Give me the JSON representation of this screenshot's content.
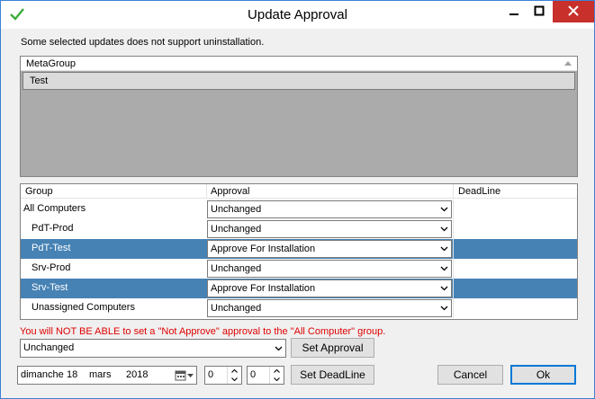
{
  "window": {
    "title": "Update Approval",
    "app_icon": "green-check-icon",
    "controls": [
      "minimize-icon",
      "maximize-icon",
      "close-icon"
    ]
  },
  "notice": "Some selected updates does not support uninstallation.",
  "metagroup_panel": {
    "header": "MetaGroup",
    "rows": [
      "Test"
    ]
  },
  "groups_panel": {
    "headers": {
      "group": "Group",
      "approval": "Approval",
      "deadline": "DeadLine"
    },
    "rows": [
      {
        "name": "All Computers",
        "approval": "Unchanged",
        "selected": false
      },
      {
        "name": "PdT-Prod",
        "approval": "Unchanged",
        "selected": false
      },
      {
        "name": "PdT-Test",
        "approval": "Approve For Installation",
        "selected": true
      },
      {
        "name": "Srv-Prod",
        "approval": "Unchanged",
        "selected": false
      },
      {
        "name": "Srv-Test",
        "approval": "Approve For Installation",
        "selected": true
      },
      {
        "name": "Unassigned Computers",
        "approval": "Unchanged",
        "selected": false
      }
    ]
  },
  "warning": "You will NOT BE ABLE to set a \"Not Approve\" approval to the \"All Computer\" group.",
  "approval_combo": {
    "value": "Unchanged"
  },
  "buttons": {
    "set_approval": "Set Approval",
    "set_deadline": "Set DeadLine",
    "cancel": "Cancel",
    "ok": "Ok"
  },
  "deadline": {
    "weekday": "dimanche",
    "day": "18",
    "month": "mars",
    "year": "2018",
    "hours": "0",
    "minutes": "0"
  },
  "colors": {
    "selected_row": "#4682b4",
    "warning_text": "#e00000",
    "close_button": "#c7302b",
    "empty_panel": "#ababab"
  }
}
